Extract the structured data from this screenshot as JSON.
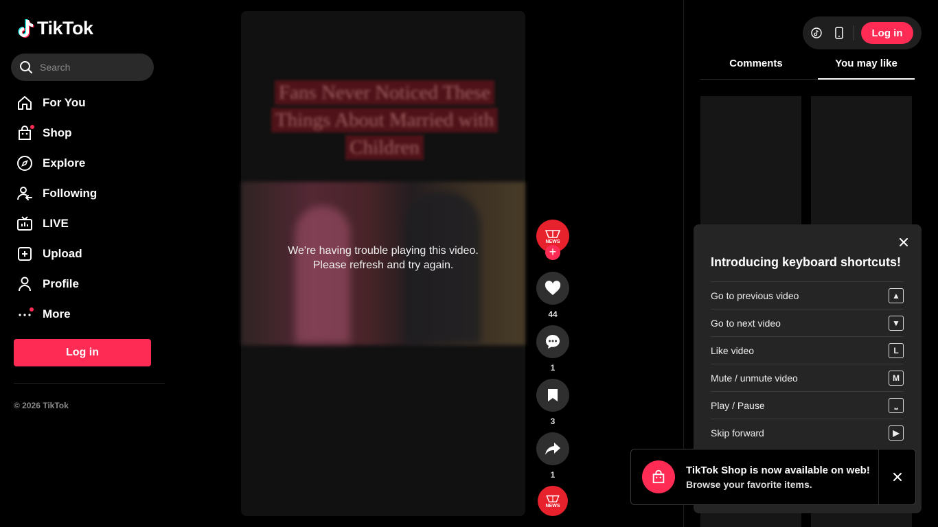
{
  "app": {
    "logo_text": "TikTok"
  },
  "search": {
    "placeholder": "Search"
  },
  "sidebar": {
    "items": [
      {
        "label": "For You",
        "icon": "home-icon"
      },
      {
        "label": "Shop",
        "icon": "shop-bag-icon"
      },
      {
        "label": "Explore",
        "icon": "compass-icon"
      },
      {
        "label": "Following",
        "icon": "following-user-icon"
      },
      {
        "label": "LIVE",
        "icon": "live-tv-icon"
      },
      {
        "label": "Upload",
        "icon": "upload-plus-icon"
      },
      {
        "label": "Profile",
        "icon": "profile-icon"
      },
      {
        "label": "More",
        "icon": "more-dots-icon"
      }
    ],
    "login_label": "Log in",
    "copyright": "© 2026 TikTok"
  },
  "video": {
    "overlay_title_lines": [
      "Fans Never Noticed These",
      "Things About Married with",
      "Children"
    ],
    "error_line1": "We're having trouble playing this video.",
    "error_line2": "Please refresh and try again."
  },
  "actions": {
    "avatar_text": "NEWS",
    "follow_symbol": "+",
    "likes": "44",
    "comments": "1",
    "saves": "3",
    "shares": "1"
  },
  "header": {
    "login_label": "Log in"
  },
  "tabs": [
    {
      "label": "Comments"
    },
    {
      "label": "You may like"
    }
  ],
  "keyboard_shortcuts": {
    "title": "Introducing keyboard shortcuts!",
    "rows": [
      {
        "label": "Go to previous video",
        "key": "▲"
      },
      {
        "label": "Go to next video",
        "key": "▼"
      },
      {
        "label": "Like video",
        "key": "L"
      },
      {
        "label": "Mute / unmute video",
        "key": "M"
      },
      {
        "label": "Play / Pause",
        "key": "⎵"
      },
      {
        "label": "Skip forward",
        "key": "▶"
      }
    ]
  },
  "toast": {
    "title": "TikTok Shop is now available on web!",
    "subtitle": "Browse your favorite items."
  },
  "colors": {
    "accent": "#fe2c55",
    "background": "#000000",
    "surface": "#252525"
  }
}
